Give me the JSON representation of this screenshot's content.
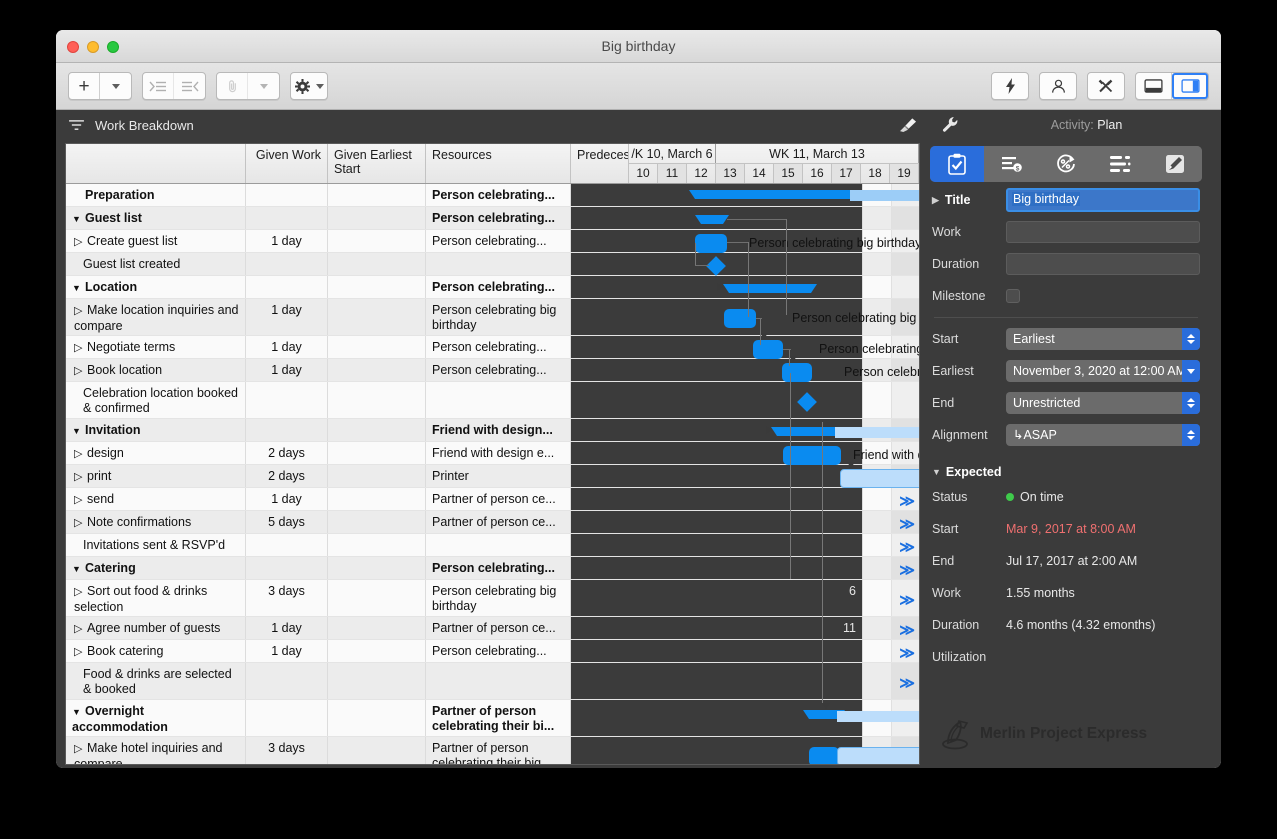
{
  "window": {
    "title": "Big birthday"
  },
  "toolbar": {
    "add_label": "+",
    "buttons": [
      {
        "name": "add-row-button",
        "icon": "plus-icon"
      },
      {
        "name": "add-row-menu-button",
        "icon": "chevron-down-icon"
      },
      {
        "name": "indent-right-button",
        "icon": "indent-right-icon"
      },
      {
        "name": "indent-left-button",
        "icon": "indent-left-icon"
      },
      {
        "name": "attachment-button",
        "icon": "paperclip-icon"
      },
      {
        "name": "attachment-menu-button",
        "icon": "chevron-down-icon"
      },
      {
        "name": "settings-button",
        "icon": "gear-icon"
      },
      {
        "name": "settings-menu-button",
        "icon": "chevron-down-icon"
      }
    ],
    "right_buttons": [
      {
        "name": "flash-button",
        "icon": "lightning-icon"
      },
      {
        "name": "resources-button",
        "icon": "person-icon"
      },
      {
        "name": "tools-button",
        "icon": "tools-icon"
      },
      {
        "name": "bottom-panel-button",
        "icon": "bottom-panel-icon"
      },
      {
        "name": "inspector-toggle-button",
        "icon": "right-panel-icon"
      }
    ]
  },
  "viewbar": {
    "view_label": "Work Breakdown",
    "view_icon": "breakdown-icon",
    "style_icon": "paintbrush-icon",
    "settings_icon": "wrench-icon",
    "activity_prefix": "Activity:",
    "activity_value": "Plan"
  },
  "table": {
    "columns": [
      {
        "key": "name",
        "label": ""
      },
      {
        "key": "work",
        "label": "Given Work"
      },
      {
        "key": "early",
        "label": "Given Earliest Start"
      },
      {
        "key": "res",
        "label": "Resources"
      },
      {
        "key": "pred",
        "label": "Predeces"
      }
    ],
    "rows": [
      {
        "name": "Preparation",
        "type": "group",
        "indent": 0,
        "disclosure": "none",
        "work": "",
        "early": "",
        "res": "Person celebrating...",
        "pred": ""
      },
      {
        "name": "Guest list",
        "type": "group",
        "indent": 0,
        "disclosure": "open",
        "work": "",
        "early": "",
        "res": "Person celebrating...",
        "pred": ""
      },
      {
        "name": "Create guest list",
        "type": "task",
        "indent": 1,
        "disclosure": "closed",
        "work": "1 day",
        "early": "",
        "res": "Person celebrating...",
        "pred": ""
      },
      {
        "name": "Guest list created",
        "type": "milestone",
        "indent": 1,
        "disclosure": "none",
        "work": "",
        "early": "",
        "res": "",
        "pred": ""
      },
      {
        "name": "Location",
        "type": "group",
        "indent": 0,
        "disclosure": "open",
        "work": "",
        "early": "",
        "res": "Person celebrating...",
        "pred": ""
      },
      {
        "name": "Make location inquiries and compare",
        "type": "task",
        "indent": 1,
        "disclosure": "closed",
        "work": "1 day",
        "early": "",
        "res": "Person celebrating big birthday",
        "pred": ""
      },
      {
        "name": "Negotiate terms",
        "type": "task",
        "indent": 1,
        "disclosure": "closed",
        "work": "1 day",
        "early": "",
        "res": "Person celebrating...",
        "pred": ""
      },
      {
        "name": "Book location",
        "type": "task",
        "indent": 1,
        "disclosure": "closed",
        "work": "1 day",
        "early": "",
        "res": "Person celebrating...",
        "pred": ""
      },
      {
        "name": "Celebration location booked & confirmed",
        "type": "milestone",
        "indent": 1,
        "disclosure": "none",
        "work": "",
        "early": "",
        "res": "",
        "pred": ""
      },
      {
        "name": "Invitation",
        "type": "group",
        "indent": 0,
        "disclosure": "open",
        "work": "",
        "early": "",
        "res": "Friend with design...",
        "pred": ""
      },
      {
        "name": "design",
        "type": "task",
        "indent": 1,
        "disclosure": "closed",
        "work": "2 days",
        "early": "",
        "res": "Friend with design e...",
        "pred": ""
      },
      {
        "name": "print",
        "type": "task",
        "indent": 1,
        "disclosure": "closed",
        "work": "2 days",
        "early": "",
        "res": "Printer",
        "pred": ""
      },
      {
        "name": "send",
        "type": "task",
        "indent": 1,
        "disclosure": "closed",
        "work": "1 day",
        "early": "",
        "res": "Partner of person ce...",
        "pred": ""
      },
      {
        "name": "Note confirmations",
        "type": "task",
        "indent": 1,
        "disclosure": "closed",
        "work": "5 days",
        "early": "",
        "res": "Partner of person ce...",
        "pred": ""
      },
      {
        "name": "Invitations sent & RSVP'd",
        "type": "milestone",
        "indent": 1,
        "disclosure": "none",
        "work": "",
        "early": "",
        "res": "",
        "pred": ""
      },
      {
        "name": "Catering",
        "type": "group",
        "indent": 0,
        "disclosure": "open",
        "work": "",
        "early": "",
        "res": "Person celebrating...",
        "pred": ""
      },
      {
        "name": "Sort out food & drinks selection",
        "type": "task",
        "indent": 1,
        "disclosure": "closed",
        "work": "3 days",
        "early": "",
        "res": "Person celebrating big birthday",
        "pred": "6"
      },
      {
        "name": "Agree number of guests",
        "type": "task",
        "indent": 1,
        "disclosure": "closed",
        "work": "1 day",
        "early": "",
        "res": "Partner of person ce...",
        "pred": "11"
      },
      {
        "name": "Book catering",
        "type": "task",
        "indent": 1,
        "disclosure": "closed",
        "work": "1 day",
        "early": "",
        "res": "Person celebrating...",
        "pred": ""
      },
      {
        "name": "Food & drinks are selected & booked",
        "type": "milestone",
        "indent": 1,
        "disclosure": "none",
        "work": "",
        "early": "",
        "res": "",
        "pred": ""
      },
      {
        "name": "Overnight accommodation",
        "type": "group",
        "indent": 0,
        "disclosure": "open",
        "work": "",
        "early": "",
        "res": "Partner of person celebrating their bi...",
        "pred": ""
      },
      {
        "name": "Make hotel inquiries and compare",
        "type": "task",
        "indent": 1,
        "disclosure": "closed",
        "work": "3 days",
        "early": "",
        "res": "Partner of person celebrating their big...",
        "pred": ""
      }
    ]
  },
  "gantt": {
    "weeks": [
      {
        "label": "/K 10, March 6",
        "days": [
          "10",
          "11",
          "12"
        ]
      },
      {
        "label": "WK 11, March 13",
        "days": [
          "13",
          "14",
          "15",
          "16",
          "17",
          "18",
          "19"
        ]
      }
    ],
    "bar_labels": [
      "Person celebrating big birthday",
      "Person celebrating big birthday",
      "Person celebrating big bi",
      "Person celebrating",
      "Friend with d"
    ],
    "overflow_marker": "≫"
  },
  "inspector": {
    "tabs": [
      {
        "name": "tab-info",
        "icon": "clipboard-check-icon",
        "active": true
      },
      {
        "name": "tab-costs",
        "icon": "list-money-icon",
        "active": false
      },
      {
        "name": "tab-progress",
        "icon": "percent-clock-icon",
        "active": false
      },
      {
        "name": "tab-attributes",
        "icon": "bullet-list-icon",
        "active": false
      },
      {
        "name": "tab-notes",
        "icon": "pencil-icon",
        "active": false
      }
    ],
    "title_label": "Title",
    "title_value": "Big birthday",
    "fields": [
      {
        "label": "Work",
        "value": "",
        "kind": "input"
      },
      {
        "label": "Duration",
        "value": "",
        "kind": "input"
      },
      {
        "label": "Milestone",
        "value": "",
        "kind": "checkbox"
      }
    ],
    "scheduling": [
      {
        "label": "Start",
        "value": "Earliest",
        "kind": "stepper"
      },
      {
        "label": "Earliest",
        "value": "November 3, 2020 at 12:00 AM",
        "kind": "popup"
      },
      {
        "label": "End",
        "value": "Unrestricted",
        "kind": "stepper"
      },
      {
        "label": "Alignment",
        "value": "↳ASAP",
        "kind": "stepper"
      }
    ],
    "expected_label": "Expected",
    "expected": [
      {
        "label": "Status",
        "value": "On time",
        "dot": "#3fcb4b"
      },
      {
        "label": "Start",
        "value": "Mar 9, 2017 at 8:00 AM",
        "color": "#ef7070"
      },
      {
        "label": "End",
        "value": "Jul 17, 2017 at 2:00 AM"
      },
      {
        "label": "Work",
        "value": "1.55 months"
      },
      {
        "label": "Duration",
        "value": "4.6 months (4.32 emonths)"
      },
      {
        "label": "Utilization",
        "value": ""
      }
    ],
    "brand": "Merlin Project Express"
  },
  "colors": {
    "accent": "#0a8bf0",
    "select": "#2a6ddb",
    "status_ok": "#3fcb4b",
    "warn": "#ef7070"
  }
}
